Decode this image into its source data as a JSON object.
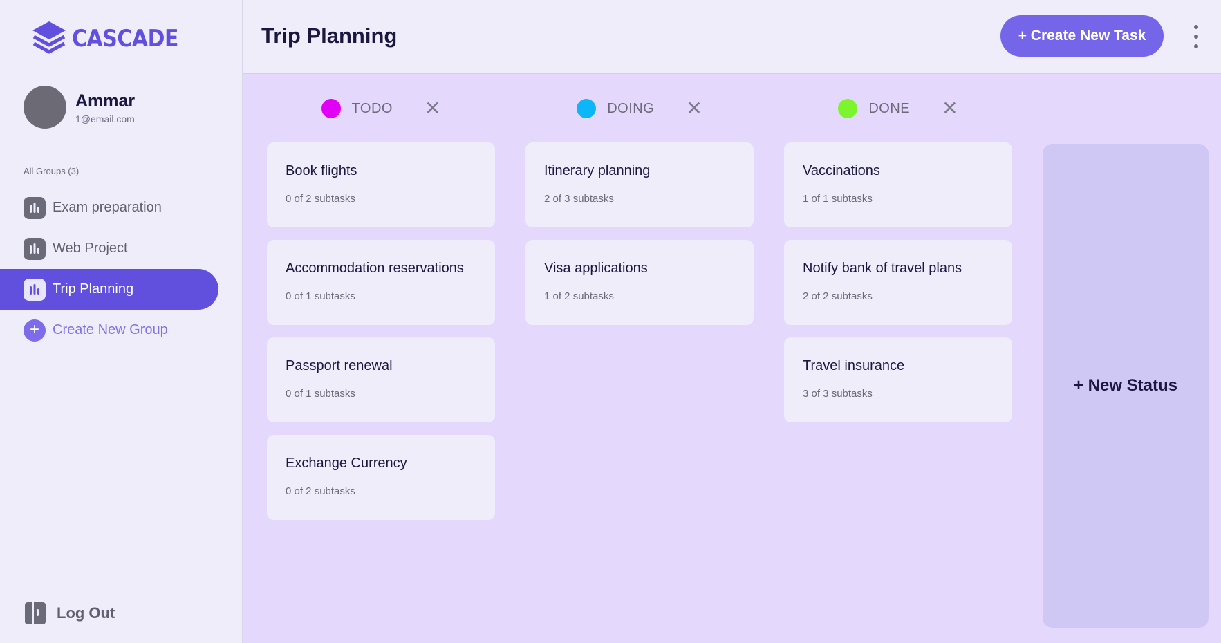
{
  "app": {
    "logo_text": "CASCADE",
    "accent": "#6150dd"
  },
  "user": {
    "name": "Ammar",
    "email": "1@email.com"
  },
  "sidebar": {
    "groups_label": "All Groups (3)",
    "items": [
      {
        "label": "Exam preparation",
        "icon": "bar-chart-icon",
        "active": false
      },
      {
        "label": "Web Project",
        "icon": "bar-chart-icon",
        "active": false
      },
      {
        "label": "Trip Planning",
        "icon": "bar-chart-icon",
        "active": true
      }
    ],
    "create_group_label": "Create New Group",
    "logout_label": "Log Out"
  },
  "header": {
    "title": "Trip Planning",
    "create_task_label": "+ Create New Task"
  },
  "board": {
    "columns": [
      {
        "name": "TODO",
        "color": "#e100f5",
        "cards": [
          {
            "title": "Book flights",
            "subtasks": "0 of 2 subtasks"
          },
          {
            "title": "Accommodation reservations",
            "subtasks": "0 of 1 subtasks"
          },
          {
            "title": "Passport renewal",
            "subtasks": "0 of 1 subtasks"
          },
          {
            "title": "Exchange Currency",
            "subtasks": "0 of 2 subtasks"
          }
        ]
      },
      {
        "name": "DOING",
        "color": "#0db7f7",
        "cards": [
          {
            "title": "Itinerary planning",
            "subtasks": "2 of 3 subtasks"
          },
          {
            "title": "Visa applications",
            "subtasks": "1 of 2 subtasks"
          }
        ]
      },
      {
        "name": "DONE",
        "color": "#7cf52e",
        "cards": [
          {
            "title": "Vaccinations",
            "subtasks": "1 of 1 subtasks"
          },
          {
            "title": "Notify bank of travel plans",
            "subtasks": "2 of 2 subtasks"
          },
          {
            "title": "Travel insurance",
            "subtasks": "3 of 3 subtasks"
          }
        ]
      }
    ],
    "close_symbol": "✕",
    "new_status_label": "+ New Status"
  }
}
